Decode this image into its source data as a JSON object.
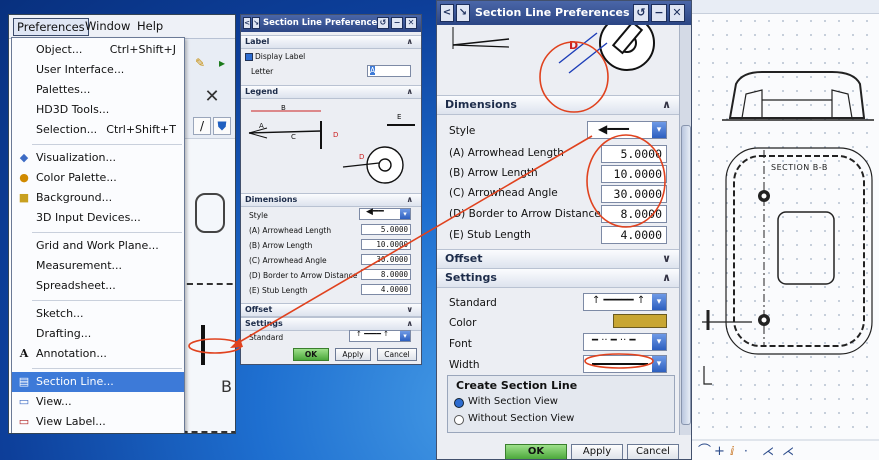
{
  "menubar": {
    "preferences": "Preferences",
    "window": "Window",
    "help": "Help"
  },
  "menu": {
    "items": [
      {
        "label": "Object...",
        "shortcut": "Ctrl+Shift+J",
        "icon": ""
      },
      {
        "label": "User Interface...",
        "shortcut": "",
        "icon": ""
      },
      {
        "label": "Palettes...",
        "shortcut": "",
        "icon": ""
      },
      {
        "label": "HD3D Tools...",
        "shortcut": "",
        "icon": ""
      },
      {
        "label": "Selection...",
        "shortcut": "Ctrl+Shift+T",
        "icon": ""
      },
      {
        "label": "Visualization...",
        "shortcut": "",
        "icon": "visualization-icon"
      },
      {
        "label": "Color Palette...",
        "shortcut": "",
        "icon": "color-palette-icon"
      },
      {
        "label": "Background...",
        "shortcut": "",
        "icon": "background-icon"
      },
      {
        "label": "3D Input Devices...",
        "shortcut": "",
        "icon": ""
      },
      {
        "label": "Grid and Work Plane...",
        "shortcut": "",
        "icon": ""
      },
      {
        "label": "Measurement...",
        "shortcut": "",
        "icon": ""
      },
      {
        "label": "Spreadsheet...",
        "shortcut": "",
        "icon": ""
      },
      {
        "label": "Sketch...",
        "shortcut": "",
        "icon": ""
      },
      {
        "label": "Drafting...",
        "shortcut": "",
        "icon": ""
      },
      {
        "label": "Annotation...",
        "shortcut": "",
        "icon": "annotation-icon"
      },
      {
        "label": "Section Line...",
        "shortcut": "",
        "icon": "section-line-icon"
      },
      {
        "label": "View...",
        "shortcut": "",
        "icon": "view-icon"
      },
      {
        "label": "View Label...",
        "shortcut": "",
        "icon": "view-label-icon"
      }
    ],
    "selected": "Section Line..."
  },
  "dialog_title": "Section Line Preferences",
  "small_dialog": {
    "label_section": "Label",
    "display_label": "Display Label",
    "letter_label": "Letter",
    "letter_value": "A",
    "legend_section": "Legend",
    "dimensions_section": "Dimensions",
    "style_label": "Style",
    "offset_section": "Offset",
    "settings_section": "Settings",
    "standard_label": "Standard",
    "ok": "OK",
    "apply": "Apply",
    "cancel": "Cancel"
  },
  "dimensions": {
    "arrowhead_length_label": "(A) Arrowhead Length",
    "arrowhead_length": "5.0000",
    "arrow_length_label": "(B) Arrow Length",
    "arrow_length": "10.0000",
    "arrowhead_angle_label": "(C) Arrowhead Angle",
    "arrowhead_angle": "30.0000",
    "border_distance_label": "(D) Border to Arrow Distance",
    "border_distance": "8.0000",
    "stub_length_label": "(E) Stub Length",
    "stub_length": "4.0000"
  },
  "big_dialog": {
    "dimensions_section": "Dimensions",
    "style_label": "Style",
    "offset_section": "Offset",
    "settings_section": "Settings",
    "standard_label": "Standard",
    "color_label": "Color",
    "font_label": "Font",
    "width_label": "Width",
    "create_group": "Create Section Line",
    "with_section_view": "With Section View",
    "without_section_view": "Without Section View",
    "ok": "OK",
    "apply": "Apply",
    "cancel": "Cancel"
  },
  "drawing": {
    "section_label": "SECTION B-B",
    "legend_letters": [
      "A",
      "B",
      "C",
      "D",
      "E"
    ],
    "small_b": "B"
  },
  "colors": {
    "titlebar": "#2b4584",
    "selection": "#3d7ad8",
    "color_swatch": "#c8a633",
    "annotation": "#e0421e"
  }
}
